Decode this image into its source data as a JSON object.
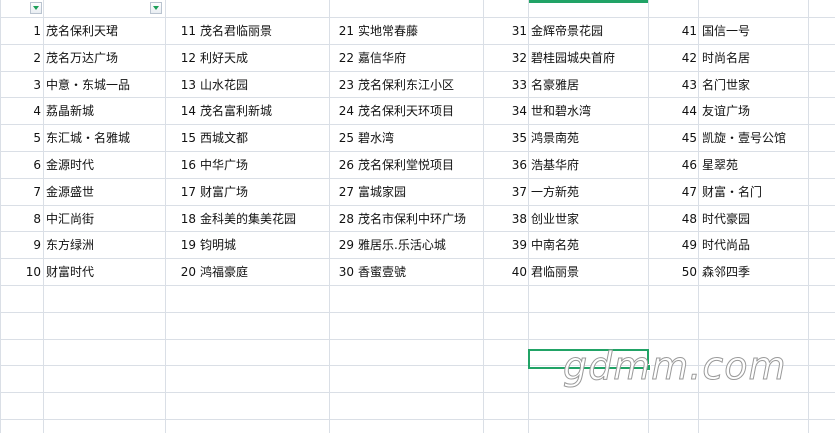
{
  "columns": [
    {
      "items": [
        {
          "num": "1",
          "name": "茂名保利天珺"
        },
        {
          "num": "2",
          "name": "茂名万达广场"
        },
        {
          "num": "3",
          "name": "中意・东城一品"
        },
        {
          "num": "4",
          "name": "荔晶新城"
        },
        {
          "num": "5",
          "name": "东汇城・名雅城"
        },
        {
          "num": "6",
          "name": "金源时代"
        },
        {
          "num": "7",
          "name": "金源盛世"
        },
        {
          "num": "8",
          "name": "中汇尚街"
        },
        {
          "num": "9",
          "name": "东方绿洲"
        },
        {
          "num": "10",
          "name": "财富时代"
        }
      ]
    },
    {
      "items": [
        {
          "num": "11",
          "name": "茂名君临丽景"
        },
        {
          "num": "12",
          "name": "利好天成"
        },
        {
          "num": "13",
          "name": "山水花园"
        },
        {
          "num": "14",
          "name": "茂名富利新城"
        },
        {
          "num": "15",
          "name": "西城文都"
        },
        {
          "num": "16",
          "name": "中华广场"
        },
        {
          "num": "17",
          "name": "财富广场"
        },
        {
          "num": "18",
          "name": "金科美的集美花园"
        },
        {
          "num": "19",
          "name": "钧明城"
        },
        {
          "num": "20",
          "name": "鸿福豪庭"
        }
      ]
    },
    {
      "items": [
        {
          "num": "21",
          "name": "实地常春藤"
        },
        {
          "num": "22",
          "name": "嘉信华府"
        },
        {
          "num": "23",
          "name": "茂名保利东江小区"
        },
        {
          "num": "24",
          "name": "茂名保利天环项目"
        },
        {
          "num": "25",
          "name": "碧水湾"
        },
        {
          "num": "26",
          "name": "茂名保利堂悦项目"
        },
        {
          "num": "27",
          "name": "富城家园"
        },
        {
          "num": "28",
          "name": "茂名市保利中环广场"
        },
        {
          "num": "29",
          "name": "雅居乐.乐活心城"
        },
        {
          "num": "30",
          "name": "香蜜壹號"
        }
      ]
    },
    {
      "items": [
        {
          "num": "31",
          "name": "金辉帝景花园"
        },
        {
          "num": "32",
          "name": "碧桂园城央首府"
        },
        {
          "num": "33",
          "name": "名豪雅居"
        },
        {
          "num": "34",
          "name": "世和碧水湾"
        },
        {
          "num": "35",
          "name": "鸿景南苑"
        },
        {
          "num": "36",
          "name": "浩基华府"
        },
        {
          "num": "37",
          "name": "一方新苑"
        },
        {
          "num": "38",
          "name": "创业世家"
        },
        {
          "num": "39",
          "name": "中南名苑"
        },
        {
          "num": "40",
          "name": "君临丽景"
        }
      ]
    },
    {
      "items": [
        {
          "num": "41",
          "name": "国信一号"
        },
        {
          "num": "42",
          "name": "时尚名居"
        },
        {
          "num": "43",
          "name": "名门世家"
        },
        {
          "num": "44",
          "name": "友谊广场"
        },
        {
          "num": "45",
          "name": "凯旋・壹号公馆"
        },
        {
          "num": "46",
          "name": "星翠苑"
        },
        {
          "num": "47",
          "name": "财富・名门"
        },
        {
          "num": "48",
          "name": "时代豪园"
        },
        {
          "num": "49",
          "name": "时代尚品"
        },
        {
          "num": "50",
          "name": "森邻四季"
        }
      ]
    }
  ],
  "watermark": "gdmm.com",
  "colors": {
    "grid": "#dadfe6",
    "selection": "#21a366",
    "filter_arrow": "#1d9f58"
  }
}
